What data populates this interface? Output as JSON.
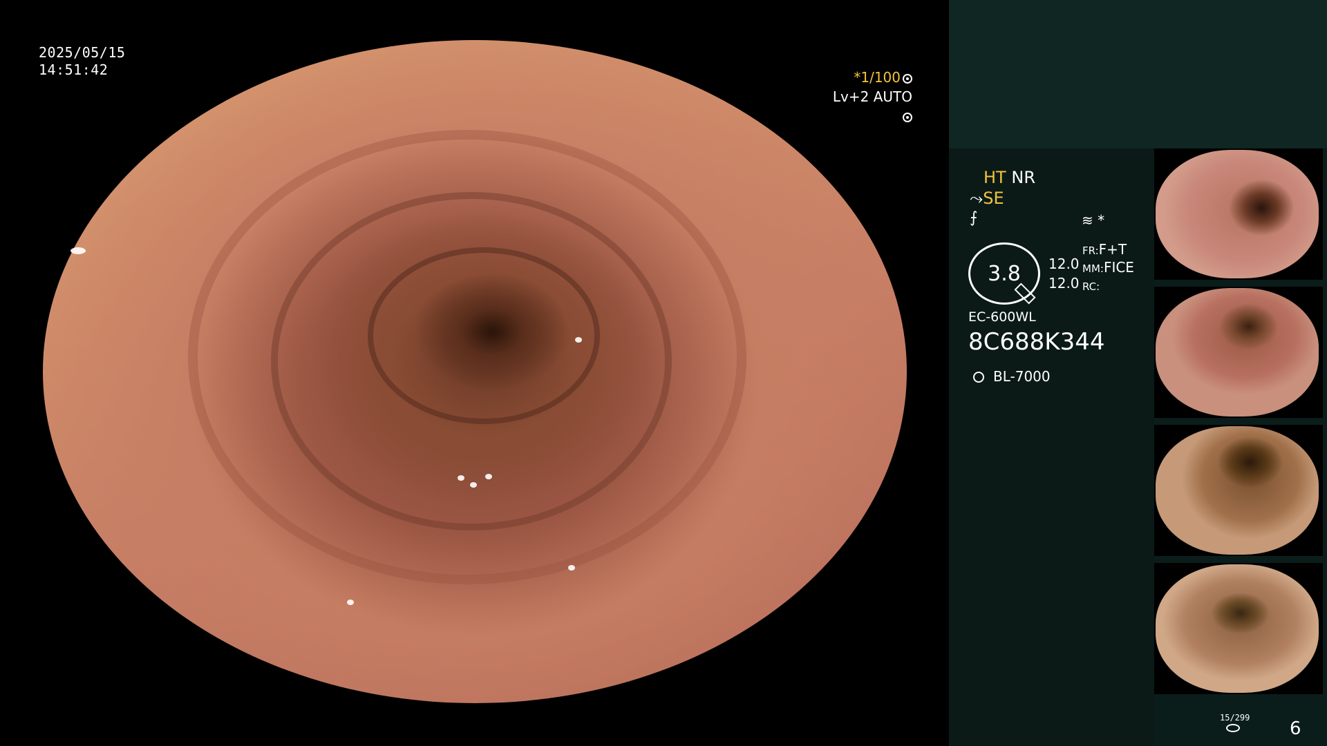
{
  "overlay": {
    "date": "2025/05/15",
    "time": "14:51:42",
    "zoom_shutter": "*1/100",
    "level_mode": "Lv+2 AUTO"
  },
  "panel": {
    "mode_ht": "HT",
    "mode_nr": "NR",
    "mode_se": "SE",
    "mode_icon3": "⨍",
    "icons": "≋ *",
    "meter_value": "3.8",
    "val1": "12.0",
    "val2": "12.0",
    "label_fr": "FR:",
    "label_fr_val": "F+T",
    "label_mm": "MM:",
    "label_mm_val": "FICE",
    "label_rc": "RC:",
    "scope_model": "EC-600WL",
    "scope_serial": "8C688K344",
    "light_source": "BL-7000",
    "counter": "15/299",
    "page_number": "6"
  },
  "thumbnails": [
    {
      "name": "thumbnail-1"
    },
    {
      "name": "thumbnail-2"
    },
    {
      "name": "thumbnail-3"
    },
    {
      "name": "thumbnail-4"
    }
  ],
  "colors": {
    "accent_yellow": "#f2c43a",
    "panel_bg": "#0b1d1a"
  }
}
